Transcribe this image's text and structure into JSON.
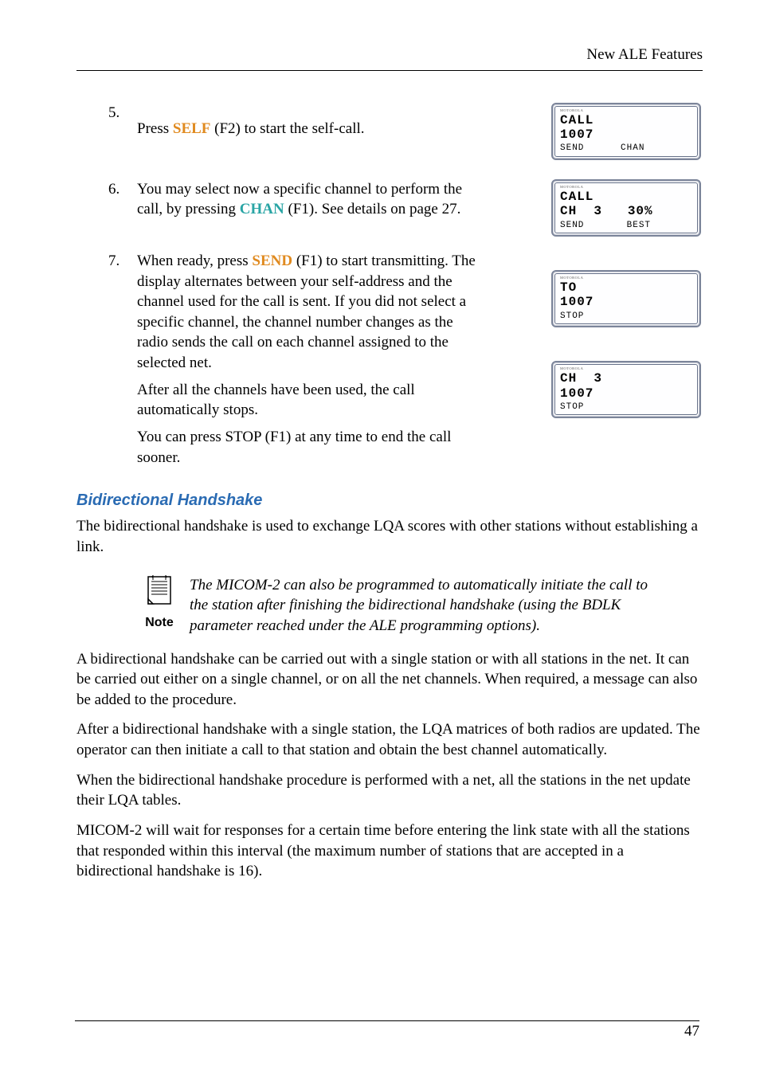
{
  "header": {
    "title": "New ALE Features"
  },
  "steps": {
    "s5": {
      "num": "5.",
      "text": "Press ",
      "key": "SELF",
      "after": " (F2) to start the self-call."
    },
    "s6": {
      "num": "6.",
      "t1": "You may select now a specific channel to perform the call, by pressing ",
      "key": "CHAN",
      "t2": " (F1). See details on page 27."
    },
    "s7": {
      "num": "7.",
      "t1": "When ready, press ",
      "key": "SEND",
      "t2": " (F1) to start transmitting. The display alternates between your self-address and the channel used for the call is sent. If you did not select a specific channel, the channel number changes as the radio sends the call on each channel assigned to the selected net.",
      "p2": "After all the channels have been used, the call automatically stops.",
      "p3": "You can press STOP (F1) at any time to end the call sooner."
    }
  },
  "lcd": {
    "brand": "MOTOROLA",
    "d1": {
      "l1": "CALL",
      "l2": "1007",
      "soft": "SEND      CHAN"
    },
    "d2": {
      "l1": "CALL",
      "l2": "CH  3   30%",
      "soft": "SEND       BEST"
    },
    "d3": {
      "l1": "TO",
      "l2": "1007",
      "soft": "STOP"
    },
    "d4": {
      "l1": "CH  3",
      "l2": "1007",
      "soft": "STOP"
    }
  },
  "section": {
    "title": "Bidirectional Handshake",
    "p1": "The bidirectional handshake is used to exchange LQA scores with other stations without establishing a link.",
    "note_label": "Note",
    "note_text": "The MICOM-2 can also be programmed to automatically initiate the call to the station after finishing the bidirectional handshake (using the BDLK parameter reached under the ALE programming options).",
    "p2": "A bidirectional handshake can be carried out with a single station or with all stations in the net. It can be carried out either on a single channel, or on all the net channels. When required, a message can also be added to the procedure.",
    "p3": "After a bidirectional handshake with a single station, the LQA matrices of both radios are updated. The operator can then initiate a call to that station and obtain the best channel automatically.",
    "p4": "When the bidirectional handshake procedure is performed with a net, all the stations in the net update their LQA tables.",
    "p5": "MICOM-2 will wait for responses for a certain time before entering the link state with all the stations that responded within this interval (the maximum number of stations that are accepted in a bidirectional handshake is 16)."
  },
  "page_number": "47"
}
